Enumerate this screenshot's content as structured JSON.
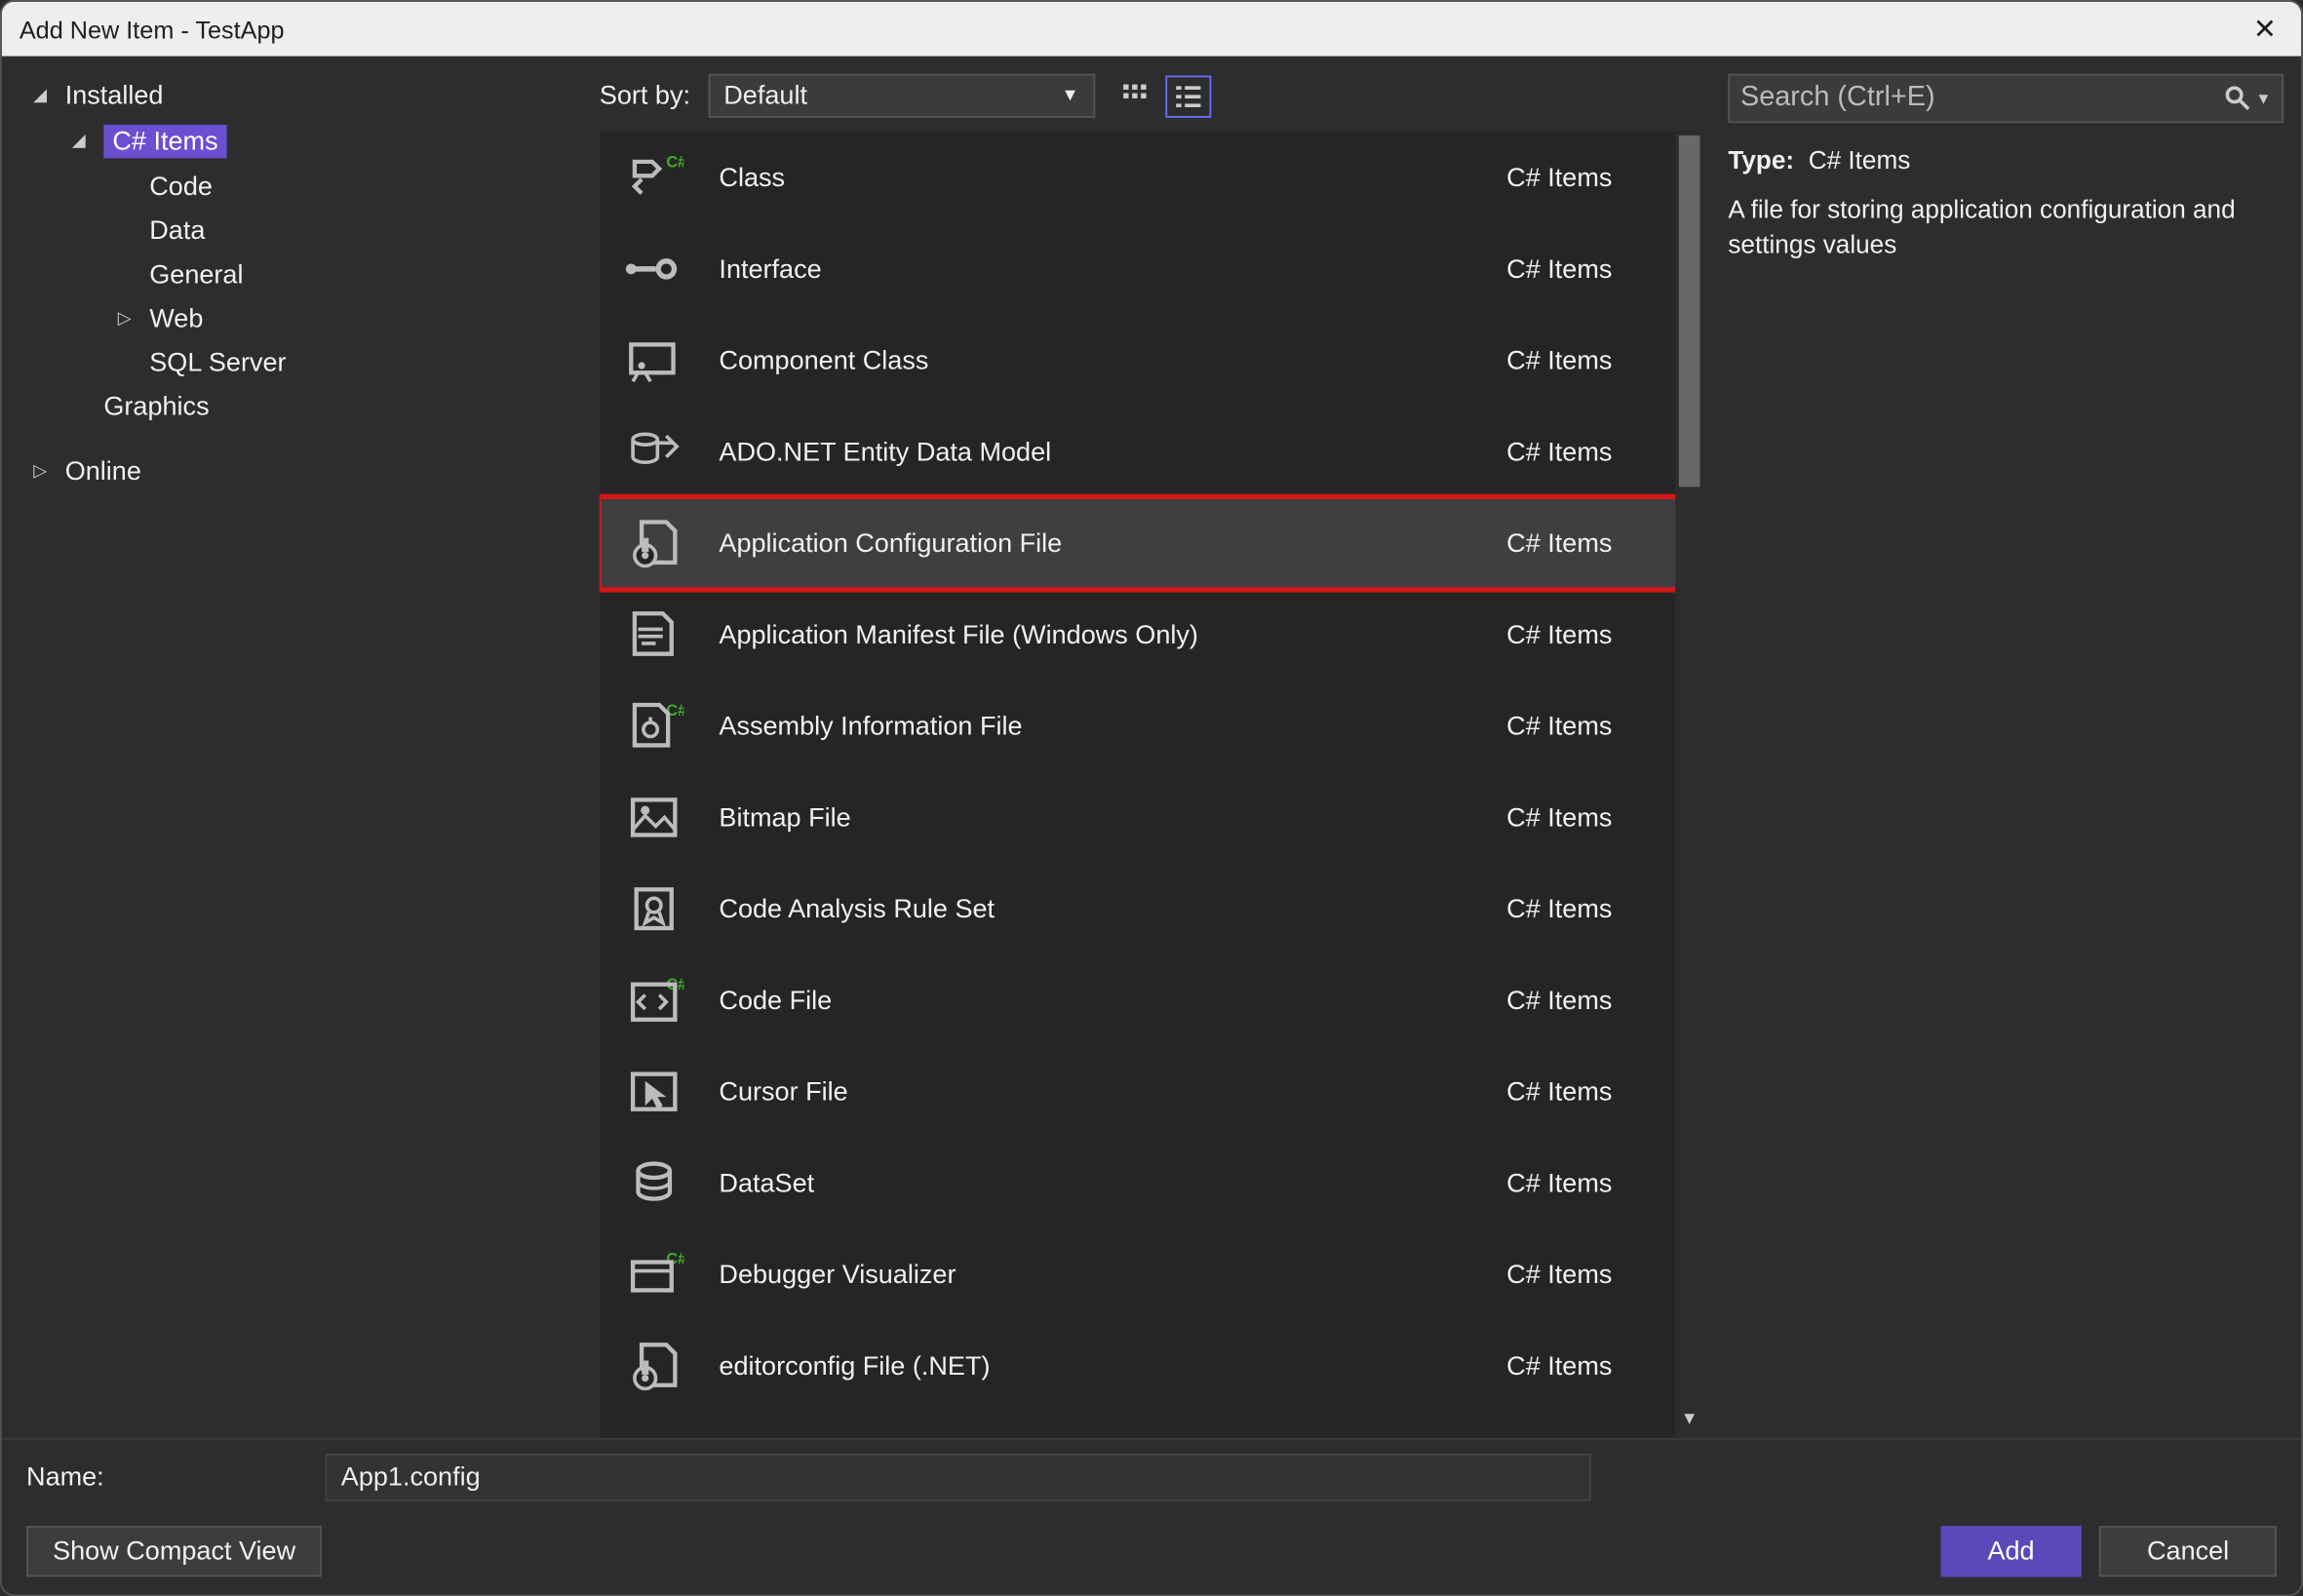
{
  "window_title": "Add New Item - TestApp",
  "tree": {
    "installed": "Installed",
    "csharp_items": "C# Items",
    "code": "Code",
    "data": "Data",
    "general": "General",
    "web": "Web",
    "sql_server": "SQL Server",
    "graphics": "Graphics",
    "online": "Online"
  },
  "sort": {
    "label": "Sort by:",
    "selected": "Default"
  },
  "search": {
    "placeholder": "Search (Ctrl+E)"
  },
  "templates": [
    {
      "name": "Class",
      "category": "C# Items",
      "icon": "class"
    },
    {
      "name": "Interface",
      "category": "C# Items",
      "icon": "interface"
    },
    {
      "name": "Component Class",
      "category": "C# Items",
      "icon": "component"
    },
    {
      "name": "ADO.NET Entity Data Model",
      "category": "C# Items",
      "icon": "ado"
    },
    {
      "name": "Application Configuration File",
      "category": "C# Items",
      "icon": "config",
      "selected": true,
      "highlighted": true
    },
    {
      "name": "Application Manifest File (Windows Only)",
      "category": "C# Items",
      "icon": "manifest"
    },
    {
      "name": "Assembly Information File",
      "category": "C# Items",
      "icon": "assembly"
    },
    {
      "name": "Bitmap File",
      "category": "C# Items",
      "icon": "bitmap"
    },
    {
      "name": "Code Analysis Rule Set",
      "category": "C# Items",
      "icon": "ruleset"
    },
    {
      "name": "Code File",
      "category": "C# Items",
      "icon": "codefile"
    },
    {
      "name": "Cursor File",
      "category": "C# Items",
      "icon": "cursor"
    },
    {
      "name": "DataSet",
      "category": "C# Items",
      "icon": "dataset"
    },
    {
      "name": "Debugger Visualizer",
      "category": "C# Items",
      "icon": "debugger"
    },
    {
      "name": "editorconfig File (.NET)",
      "category": "C# Items",
      "icon": "editorconfig"
    }
  ],
  "details": {
    "type_label": "Type:",
    "type_value": "C# Items",
    "description": "A file for storing application configuration and settings values"
  },
  "name_field": {
    "label": "Name:",
    "value": "App1.config"
  },
  "buttons": {
    "compact": "Show Compact View",
    "add": "Add",
    "cancel": "Cancel"
  }
}
